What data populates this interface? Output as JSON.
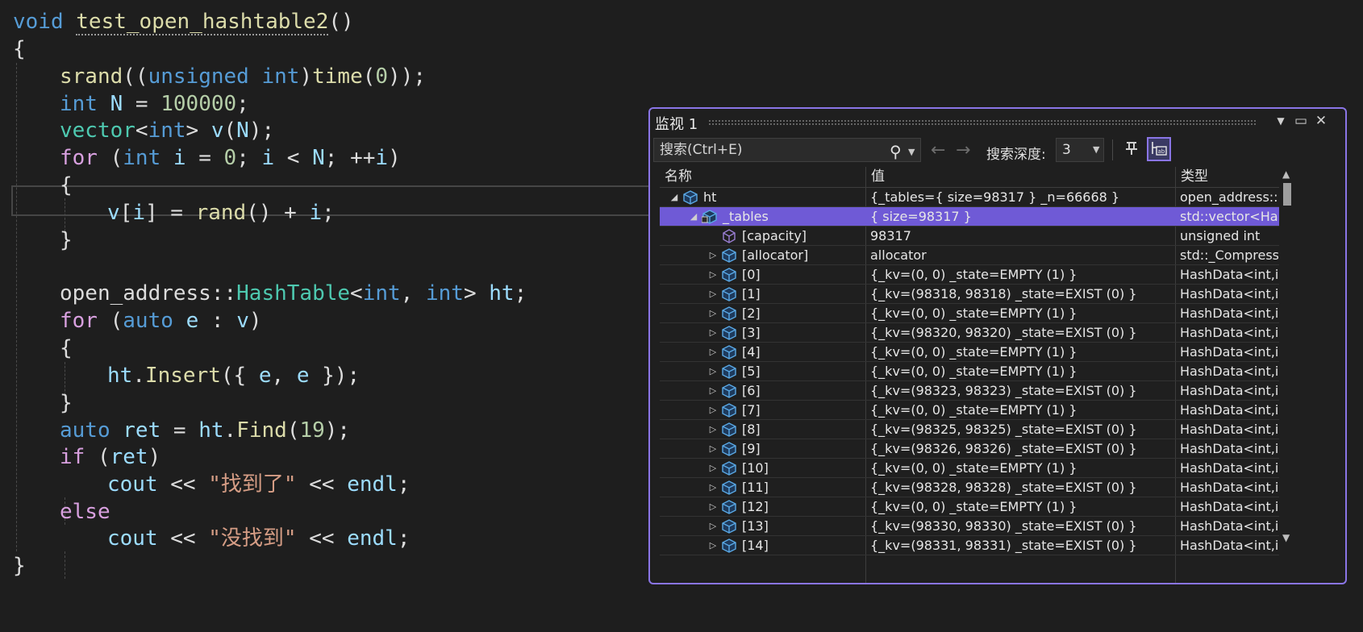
{
  "editor": {
    "lines": [
      "void test_open_hashtable2()",
      "{",
      "srand((unsigned int)time(0));",
      "int N = 100000;",
      "vector<int> v(N);",
      "for (int i = 0; i < N; ++i)",
      "{",
      "v[i] = rand() + i;",
      "}",
      "open_address::HashTable<int, int> ht;",
      "for (auto e : v)",
      "{",
      "ht.Insert({ e, e });",
      "}",
      "auto ret = ht.Find(19);",
      "if (ret)",
      "cout << \"找到了\" << endl;",
      "else",
      "cout << \"没找到\" << endl;",
      "}"
    ]
  },
  "watch": {
    "title": "监视 1",
    "search_placeholder": "搜索(Ctrl+E)",
    "depth_label": "搜索深度:",
    "depth_value": "3",
    "columns": {
      "name": "名称",
      "value": "值",
      "type": "类型"
    },
    "rows": [
      {
        "name": "ht",
        "value": "{_tables={ size=98317 } _n=66668 }",
        "type": "open_address::..."
      },
      {
        "name": "_tables",
        "value": "{ size=98317 }",
        "type": "std::vector<Has..."
      },
      {
        "name": "[capacity]",
        "value": "98317",
        "type": "unsigned int"
      },
      {
        "name": "[allocator]",
        "value": "allocator",
        "type": "std::_Compress..."
      },
      {
        "name": "[0]",
        "value": "{_kv=(0, 0) _state=EMPTY (1) }",
        "type": "HashData<int,i..."
      },
      {
        "name": "[1]",
        "value": "{_kv=(98318, 98318) _state=EXIST (0) }",
        "type": "HashData<int,i..."
      },
      {
        "name": "[2]",
        "value": "{_kv=(0, 0) _state=EMPTY (1) }",
        "type": "HashData<int,i..."
      },
      {
        "name": "[3]",
        "value": "{_kv=(98320, 98320) _state=EXIST (0) }",
        "type": "HashData<int,i..."
      },
      {
        "name": "[4]",
        "value": "{_kv=(0, 0) _state=EMPTY (1) }",
        "type": "HashData<int,i..."
      },
      {
        "name": "[5]",
        "value": "{_kv=(0, 0) _state=EMPTY (1) }",
        "type": "HashData<int,i..."
      },
      {
        "name": "[6]",
        "value": "{_kv=(98323, 98323) _state=EXIST (0) }",
        "type": "HashData<int,i..."
      },
      {
        "name": "[7]",
        "value": "{_kv=(0, 0) _state=EMPTY (1) }",
        "type": "HashData<int,i..."
      },
      {
        "name": "[8]",
        "value": "{_kv=(98325, 98325) _state=EXIST (0) }",
        "type": "HashData<int,i..."
      },
      {
        "name": "[9]",
        "value": "{_kv=(98326, 98326) _state=EXIST (0) }",
        "type": "HashData<int,i..."
      },
      {
        "name": "[10]",
        "value": "{_kv=(0, 0) _state=EMPTY (1) }",
        "type": "HashData<int,i..."
      },
      {
        "name": "[11]",
        "value": "{_kv=(98328, 98328) _state=EXIST (0) }",
        "type": "HashData<int,i..."
      },
      {
        "name": "[12]",
        "value": "{_kv=(0, 0) _state=EMPTY (1) }",
        "type": "HashData<int,i..."
      },
      {
        "name": "[13]",
        "value": "{_kv=(98330, 98330) _state=EXIST (0) }",
        "type": "HashData<int,i..."
      },
      {
        "name": "[14]",
        "value": "{_kv=(98331, 98331) _state=EXIST (0) }",
        "type": "HashData<int,i..."
      }
    ]
  },
  "colors": {
    "accent": "#8a75e6",
    "selection": "#6f5ad6",
    "background": "#1e1e1e"
  },
  "icons": {
    "search": "magnifier-icon",
    "pin": "pin-icon",
    "hex": "hex-display-icon",
    "object": "cube-icon"
  }
}
